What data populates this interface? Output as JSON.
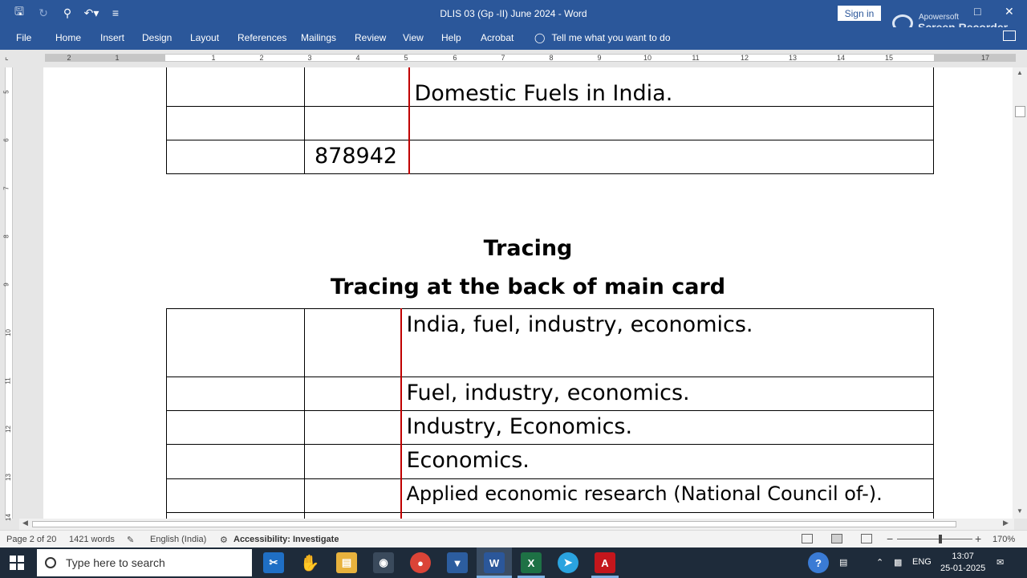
{
  "window": {
    "title": "DLIS 03 (Gp -II) June 2024  -  Word",
    "sign_in": "Sign in",
    "recorder_line1": "Apowersoft",
    "recorder_line2": "Screen Recorder"
  },
  "ribbon": {
    "tabs": [
      "File",
      "Home",
      "Insert",
      "Design",
      "Layout",
      "References",
      "Mailings",
      "Review",
      "View",
      "Help",
      "Acrobat"
    ],
    "tell_me": "Tell me what you want to do"
  },
  "ruler": {
    "numbers": [
      "2",
      "1",
      "1",
      "2",
      "3",
      "4",
      "5",
      "6",
      "7",
      "8",
      "9",
      "10",
      "11",
      "12",
      "13",
      "14",
      "15",
      "17"
    ],
    "vertical_numbers": [
      "5",
      "6",
      "7",
      "8",
      "9",
      "10",
      "11",
      "12",
      "13",
      "14"
    ]
  },
  "document": {
    "top_table": {
      "row1_col3": "Domestic Fuels in India.",
      "row3_col2": "878942"
    },
    "heading1": "Tracing",
    "heading2": "Tracing at the back of main card",
    "tracing_rows": [
      "India, fuel, industry, economics.",
      "Fuel, industry, economics.",
      "Industry, Economics.",
      "Economics.",
      "Applied economic research (National Council of-)."
    ]
  },
  "statusbar": {
    "page": "Page 2 of 20",
    "words": "1421 words",
    "language": "English (India)",
    "accessibility": "Accessibility: Investigate",
    "zoom": "170%"
  },
  "taskbar": {
    "search_placeholder": "Type here to search",
    "language": "ENG",
    "time": "13:07",
    "date": "25-01-2025"
  },
  "colors": {
    "word_blue": "#2b579a",
    "red_margin_line": "#c00000"
  }
}
